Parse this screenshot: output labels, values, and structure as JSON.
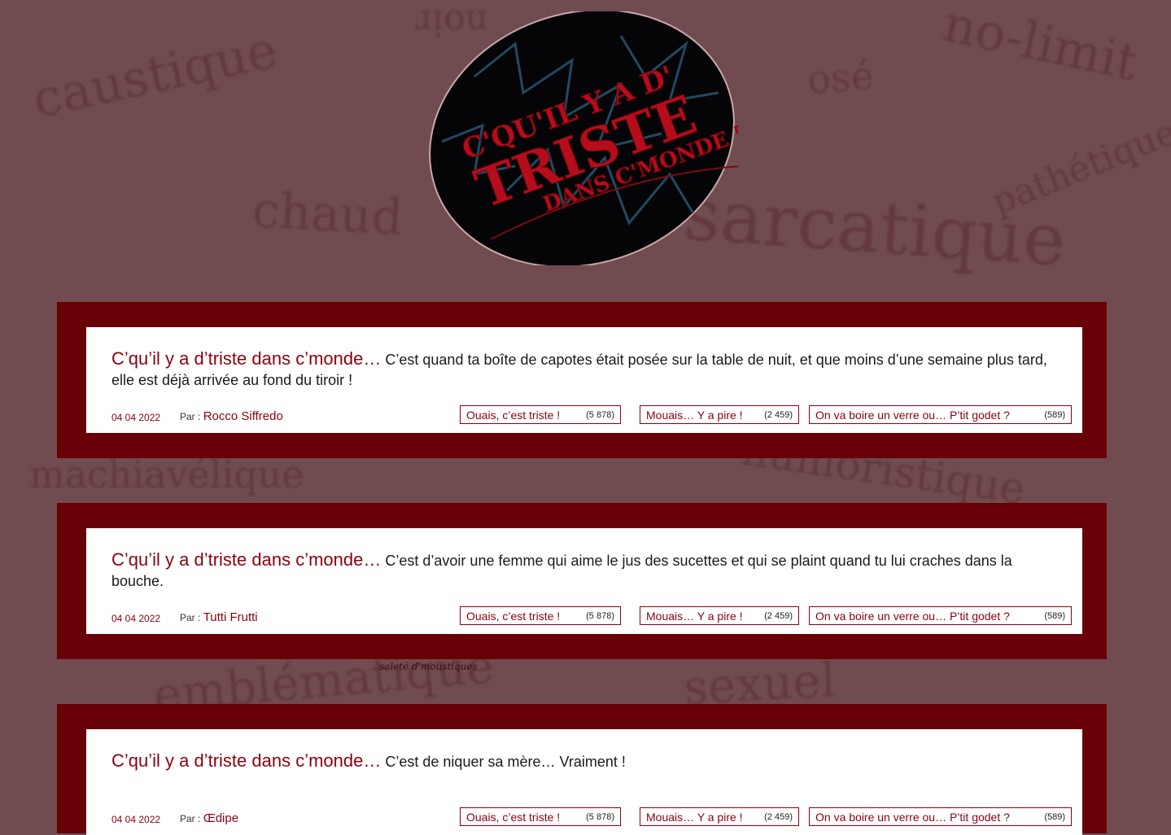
{
  "background_words": [
    "caustique",
    "noir",
    "osé",
    "no-limit",
    "chaud",
    "sarcatique",
    "pathétique",
    "machiavélique",
    "humoristique",
    "emblématique",
    "sexuel"
  ],
  "logo": {
    "line1": "C'QU'IL Y A D'",
    "line2": "TRISTE",
    "line3": "DANS C'MONDE !"
  },
  "caption": "saleté d'moustiques",
  "posts": [
    {
      "prefix": "C’qu’il y a d’triste dans c’monde…",
      "text": "C’est quand ta boîte de capotes était posée sur la table de nuit, et que moins d’une semaine plus tard, elle est déjà arrivée au fond du tiroir !",
      "date": "04 04 2022",
      "by_label": "Par :",
      "author": "Rocco Siffredo",
      "votes": [
        {
          "label": "Ouais, c’est triste !",
          "count": "(5 878)"
        },
        {
          "label": "Mouais… Y a pire !",
          "count": "(2 459)"
        },
        {
          "label": "On va boire un verre ou… P’tit godet ?",
          "count": "(589)"
        }
      ]
    },
    {
      "prefix": "C’qu’il y a d’triste dans c’monde…",
      "text": "C’est d’avoir une femme qui aime le jus des sucettes et qui se plaint quand tu lui craches dans la bouche.",
      "date": "04 04 2022",
      "by_label": "Par :",
      "author": "Tutti Frutti",
      "votes": [
        {
          "label": "Ouais, c’est triste !",
          "count": "(5 878)"
        },
        {
          "label": "Mouais… Y a pire !",
          "count": "(2 459)"
        },
        {
          "label": "On va boire un verre ou… P’tit godet ?",
          "count": "(589)"
        }
      ]
    },
    {
      "prefix": "C’qu’il y a d’triste dans c’monde…",
      "text": "C’est de niquer sa mère… Vraiment !",
      "date": "04 04 2022",
      "by_label": "Par :",
      "author": "Œdipe",
      "votes": [
        {
          "label": "Ouais, c’est triste !",
          "count": "(5 878)"
        },
        {
          "label": "Mouais… Y a pire !",
          "count": "(2 459)"
        },
        {
          "label": "On va boire un verre ou… P’tit godet ?",
          "count": "(589)"
        }
      ]
    }
  ]
}
